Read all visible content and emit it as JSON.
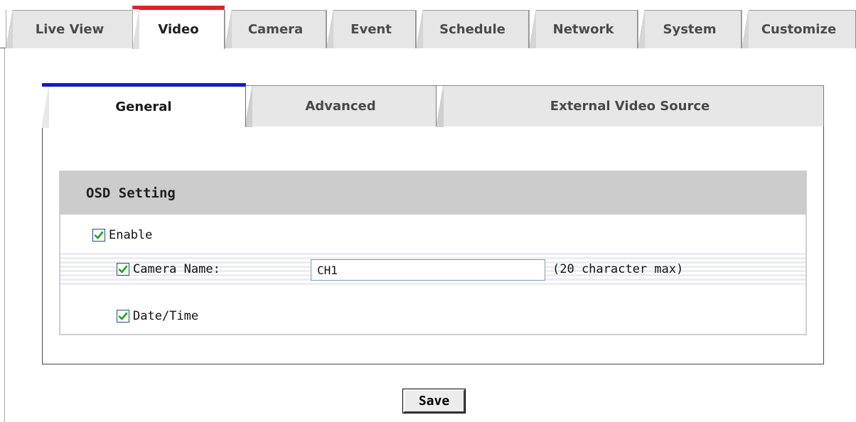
{
  "top_tabs": [
    {
      "label": "Live View",
      "active": false
    },
    {
      "label": "Video",
      "active": true
    },
    {
      "label": "Camera",
      "active": false
    },
    {
      "label": "Event",
      "active": false
    },
    {
      "label": "Schedule",
      "active": false
    },
    {
      "label": "Network",
      "active": false
    },
    {
      "label": "System",
      "active": false
    },
    {
      "label": "Customize",
      "active": false
    }
  ],
  "sub_tabs": [
    {
      "label": "General",
      "active": true
    },
    {
      "label": "Advanced",
      "active": false
    },
    {
      "label": "External Video Source",
      "active": false
    }
  ],
  "osd": {
    "title": "OSD Setting",
    "enable": {
      "label": "Enable",
      "checked": true
    },
    "camera_name": {
      "label": "Camera Name:",
      "checked": true,
      "value": "CH1",
      "hint": "(20 character max)"
    },
    "date_time": {
      "label": "Date/Time",
      "checked": true
    }
  },
  "save_label": "Save",
  "colors": {
    "active_top_tab_accent": "#e0202a",
    "active_sub_tab_accent": "#0f1bd2",
    "section_header_bg": "#cccccc",
    "checkmark": "#1aa81a"
  },
  "icons": {
    "checkbox": "check-icon"
  }
}
